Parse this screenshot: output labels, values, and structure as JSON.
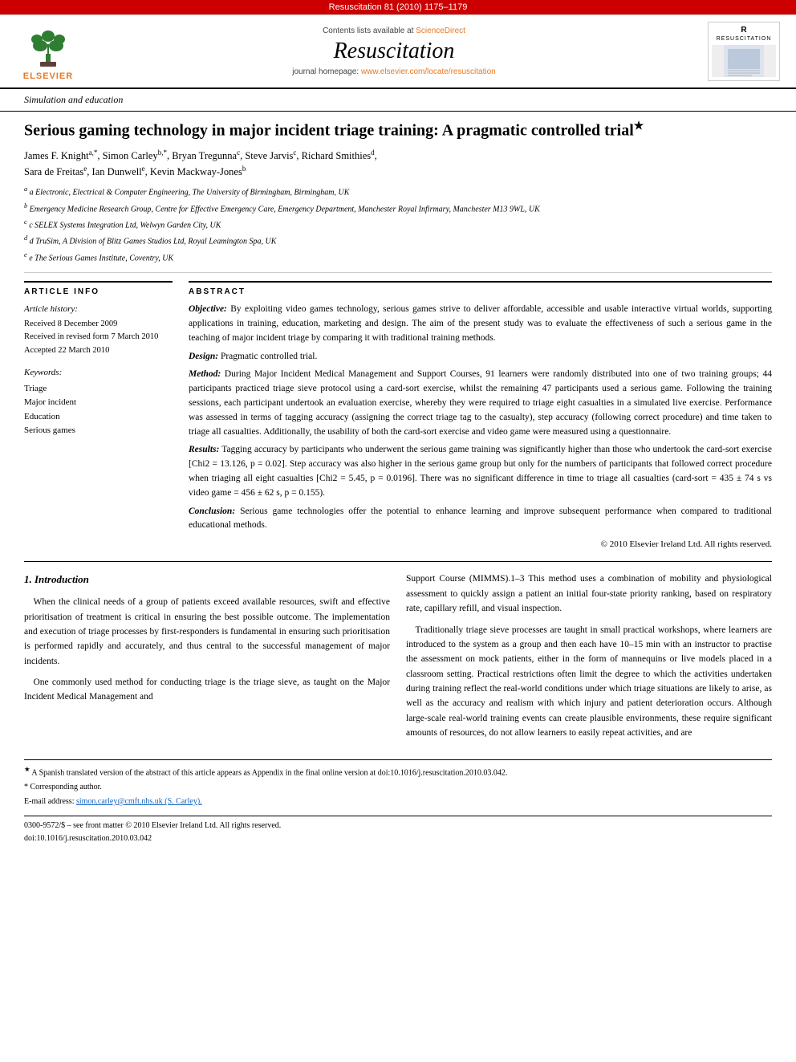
{
  "topBar": {
    "text": "Resuscitation 81 (2010) 1175–1179"
  },
  "header": {
    "sciencedirect_line": "Contents lists available at ScienceDirect",
    "journal_title": "Resuscitation",
    "journal_homepage": "journal homepage: www.elsevier.com/locate/resuscitation",
    "section_label": "Simulation and education"
  },
  "article": {
    "title": "Serious gaming technology in major incident triage training: A pragmatic controlled trial",
    "star": "★",
    "authors": "James F. Knight a,*, Simon Carley b,*, Bryan Tregunna c, Steve Jarvis c, Richard Smithies d, Sara de Freitas e, Ian Dunwell e, Kevin Mackway-Jones b",
    "affiliations": [
      "a Electronic, Electrical & Computer Engineering, The University of Birmingham, Birmingham, UK",
      "b Emergency Medicine Research Group, Centre for Effective Emergency Care, Emergency Department, Manchester Royal Infirmary, Manchester M13 9WL, UK",
      "c SELEX Systems Integration Ltd, Welwyn Garden City, UK",
      "d TruSim, A Division of Blitz Games Studios Ltd, Royal Leamington Spa, UK",
      "e The Serious Games Institute, Coventry, UK"
    ]
  },
  "articleInfo": {
    "section_title": "ARTICLE INFO",
    "history_label": "Article history:",
    "received": "Received 8 December 2009",
    "revised": "Received in revised form 7 March 2010",
    "accepted": "Accepted 22 March 2010",
    "keywords_label": "Keywords:",
    "keywords": [
      "Triage",
      "Major incident",
      "Education",
      "Serious games"
    ]
  },
  "abstract": {
    "section_title": "ABSTRACT",
    "objective_label": "Objective:",
    "objective_text": "By exploiting video games technology, serious games strive to deliver affordable, accessible and usable interactive virtual worlds, supporting applications in training, education, marketing and design. The aim of the present study was to evaluate the effectiveness of such a serious game in the teaching of major incident triage by comparing it with traditional training methods.",
    "design_label": "Design:",
    "design_text": "Pragmatic controlled trial.",
    "method_label": "Method:",
    "method_text": "During Major Incident Medical Management and Support Courses, 91 learners were randomly distributed into one of two training groups; 44 participants practiced triage sieve protocol using a card-sort exercise, whilst the remaining 47 participants used a serious game. Following the training sessions, each participant undertook an evaluation exercise, whereby they were required to triage eight casualties in a simulated live exercise. Performance was assessed in terms of tagging accuracy (assigning the correct triage tag to the casualty), step accuracy (following correct procedure) and time taken to triage all casualties. Additionally, the usability of both the card-sort exercise and video game were measured using a questionnaire.",
    "results_label": "Results:",
    "results_text": "Tagging accuracy by participants who underwent the serious game training was significantly higher than those who undertook the card-sort exercise [Chi2 = 13.126, p = 0.02]. Step accuracy was also higher in the serious game group but only for the numbers of participants that followed correct procedure when triaging all eight casualties [Chi2 = 5.45, p = 0.0196]. There was no significant difference in time to triage all casualties (card-sort = 435 ± 74 s vs video game = 456 ± 62 s, p = 0.155).",
    "conclusion_label": "Conclusion:",
    "conclusion_text": "Serious game technologies offer the potential to enhance learning and improve subsequent performance when compared to traditional educational methods.",
    "copyright": "© 2010 Elsevier Ireland Ltd. All rights reserved."
  },
  "body": {
    "section1_num": "1.",
    "section1_title": "Introduction",
    "para1": "When the clinical needs of a group of patients exceed available resources, swift and effective prioritisation of treatment is critical in ensuring the best possible outcome. The implementation and execution of triage processes by first-responders is fundamental in ensuring such prioritisation is performed rapidly and accurately, and thus central to the successful management of major incidents.",
    "para2": "One commonly used method for conducting triage is the triage sieve, as taught on the Major Incident Medical Management and",
    "para3_right": "Support Course (MIMMS).1–3 This method uses a combination of mobility and physiological assessment to quickly assign a patient an initial four-state priority ranking, based on respiratory rate, capillary refill, and visual inspection.",
    "para4_right": "Traditionally triage sieve processes are taught in small practical workshops, where learners are introduced to the system as a group and then each have 10–15 min with an instructor to practise the assessment on mock patients, either in the form of mannequins or live models placed in a classroom setting. Practical restrictions often limit the degree to which the activities undertaken during training reflect the real-world conditions under which triage situations are likely to arise, as well as the accuracy and realism with which injury and patient deterioration occurs. Although large-scale real-world training events can create plausible environments, these require significant amounts of resources, do not allow learners to easily repeat activities, and are"
  },
  "footnotes": {
    "star_note": "A Spanish translated version of the abstract of this article appears as Appendix in the final online version at doi:10.1016/j.resuscitation.2010.03.042.",
    "corresponding": "* Corresponding author.",
    "email_label": "E-mail address:",
    "email": "simon.carley@cmft.nhs.uk (S. Carley)."
  },
  "bottomBar": {
    "issn": "0300-9572/$  – see front matter © 2010 Elsevier Ireland Ltd. All rights reserved.",
    "doi": "doi:10.1016/j.resuscitation.2010.03.042"
  }
}
